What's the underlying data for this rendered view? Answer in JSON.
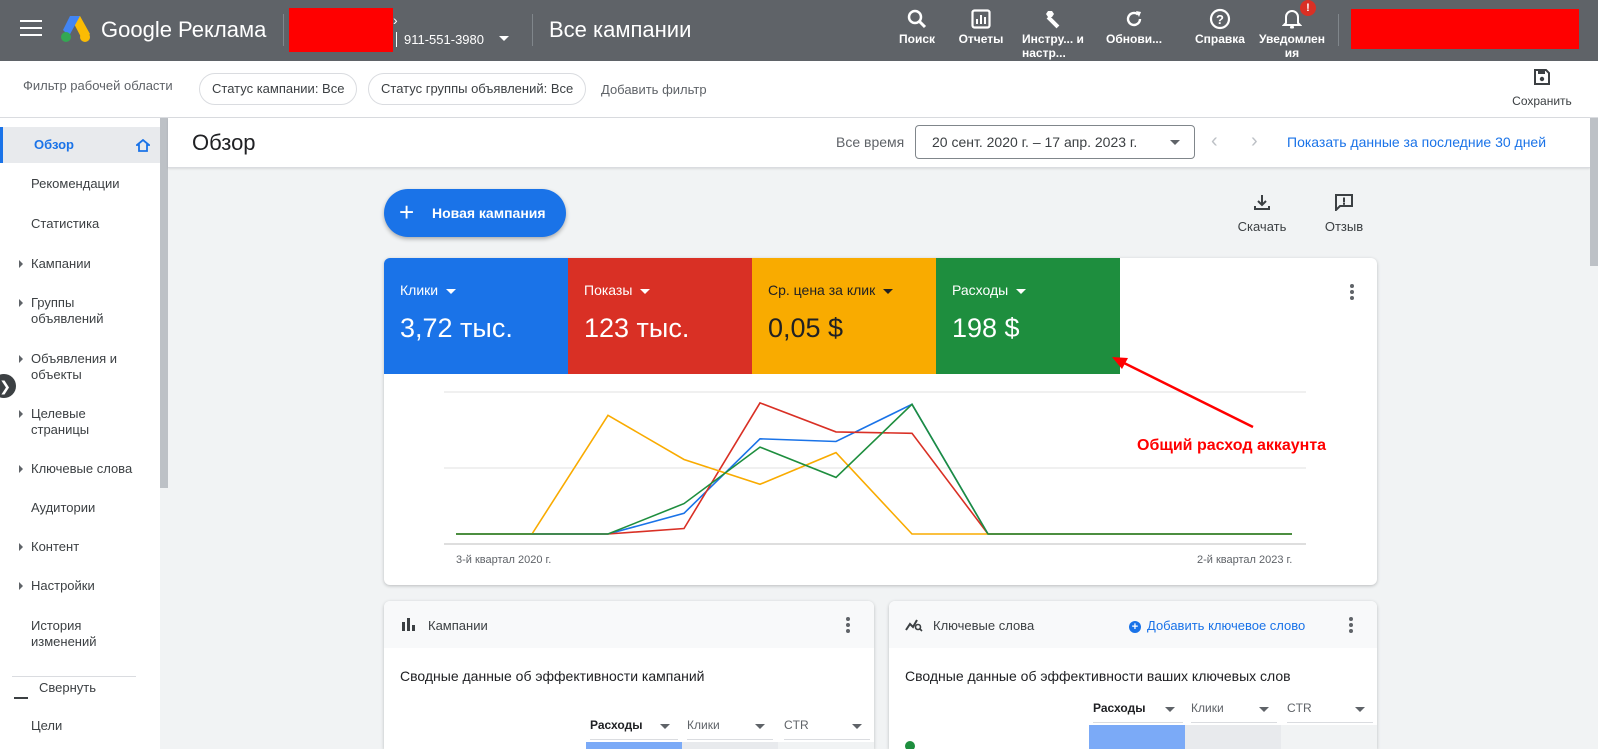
{
  "topbar": {
    "brand": "Google Реклама",
    "account_id": "911-551-3980",
    "page_title": "Все кампании",
    "tools": [
      {
        "label": "Поиск",
        "icon": "search-icon"
      },
      {
        "label": "Отчеты",
        "icon": "reports-icon"
      },
      {
        "label": "Инстру... и настр...",
        "icon": "wrench-icon"
      },
      {
        "label": "Обнови...",
        "icon": "refresh-icon"
      },
      {
        "label": "Справка",
        "icon": "help-icon"
      },
      {
        "label": "Уведомлен ия",
        "icon": "bell-icon",
        "badge": "!"
      }
    ]
  },
  "filterbar": {
    "title": "Фильтр рабочей области",
    "chips": [
      "Статус кампании: Все",
      "Статус группы объявлений: Все"
    ],
    "add_filter": "Добавить фильтр",
    "save_label": "Сохранить"
  },
  "sidebar": {
    "items": [
      {
        "label": "Обзор",
        "active": true,
        "arrow": false
      },
      {
        "label": "Рекомендации",
        "arrow": false
      },
      {
        "label": "Статистика",
        "arrow": false
      },
      {
        "label": "Кампании",
        "arrow": true
      },
      {
        "label": "Группы объявлений",
        "arrow": true
      },
      {
        "label": "Объявления и объекты",
        "arrow": true
      },
      {
        "label": "Целевые страницы",
        "arrow": true
      },
      {
        "label": "Ключевые слова",
        "arrow": true
      },
      {
        "label": "Аудитории",
        "arrow": false
      },
      {
        "label": "Контент",
        "arrow": true
      },
      {
        "label": "Настройки",
        "arrow": true
      },
      {
        "label": "История изменений",
        "arrow": false
      }
    ],
    "collapse_label": "Свернуть",
    "goals_label": "Цели"
  },
  "main": {
    "title": "Обзор",
    "range_label": "Все время",
    "date_range": "20 сент. 2020 г. – 17 апр. 2023 г.",
    "last30": "Показать данные за последние 30 дней",
    "new_campaign": "Новая кампания",
    "download": "Скачать",
    "feedback": "Отзыв"
  },
  "metrics": [
    {
      "label": "Клики",
      "value": "3,72 тыс.",
      "color": "#1a73e8"
    },
    {
      "label": "Показы",
      "value": "123 тыс.",
      "color": "#d93025"
    },
    {
      "label": "Ср. цена за клик",
      "value": "0,05 $",
      "color": "#f9ab00"
    },
    {
      "label": "Расходы",
      "value": "198 $",
      "color": "#1e8e3e"
    }
  ],
  "annotation": "Общий расход аккаунта",
  "chart_data": {
    "type": "line",
    "x_start_label": "3-й квартал 2020 г.",
    "x_end_label": "2-й квартал 2023 г.",
    "points_count": 12,
    "normalized": true,
    "series": [
      {
        "color": "#1a73e8",
        "values": [
          0,
          0,
          0,
          0.15,
          0.69,
          0.67,
          0.94,
          0,
          0,
          0,
          0,
          0
        ]
      },
      {
        "color": "#d93025",
        "values": [
          0,
          0,
          0,
          0.04,
          0.95,
          0.74,
          0.73,
          0,
          0,
          0,
          0,
          0
        ]
      },
      {
        "color": "#f9ab00",
        "values": [
          0,
          0,
          0.86,
          0.54,
          0.36,
          0.59,
          0,
          0,
          0,
          0,
          0,
          0
        ]
      },
      {
        "color": "#1e8e3e",
        "values": [
          0,
          0,
          0,
          0.22,
          0.63,
          0.41,
          0.94,
          0,
          0,
          0,
          0,
          0
        ]
      }
    ]
  },
  "campaigns_card": {
    "title": "Кампании",
    "subtitle": "Сводные данные об эффективности кампаний",
    "columns": [
      "Расходы",
      "Клики",
      "CTR"
    ]
  },
  "keywords_card": {
    "title": "Ключевые слова",
    "add_keyword": "Добавить ключевое слово",
    "subtitle": "Сводные данные об эффективности ваших ключевых слов",
    "columns": [
      "Расходы",
      "Клики",
      "CTR"
    ]
  }
}
